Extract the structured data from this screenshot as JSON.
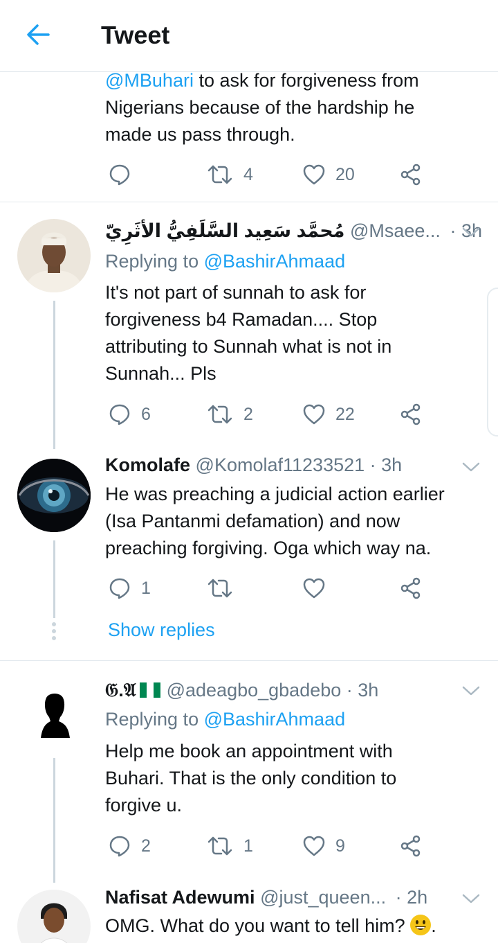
{
  "header": {
    "title": "Tweet"
  },
  "top_tweet": {
    "mention": "@MBuhari",
    "text_rest_line1": " to ask for forgiveness from",
    "text_line2": "Nigerians because of the hardship he",
    "text_line3": "made us pass through.",
    "retweets": "4",
    "likes": "20"
  },
  "replies": [
    {
      "name": "مُحمَّد سَعِيد السَّلَفِيُّ الأثَرِيّ",
      "handle": "@Msaee...",
      "time": "· 3h",
      "replying_label": "Replying to ",
      "replying_to": "@BashirAhmaad",
      "lines": [
        "It's not part of sunnah to ask for",
        "forgiveness b4 Ramadan.... Stop",
        "attributing to Sunnah what is not in",
        "Sunnah... Pls"
      ],
      "replies": "6",
      "retweets": "2",
      "likes": "22"
    },
    {
      "name": "Komolafe",
      "handle": "@Komolaf11233521",
      "time": "· 3h",
      "lines": [
        "He was preaching a judicial action earlier",
        "(Isa Pantanmi defamation) and now",
        "preaching forgiving. Oga which way na."
      ],
      "replies": "1",
      "retweets": "",
      "likes": "",
      "show_replies": "Show replies"
    },
    {
      "name": "𝔊.𝔄",
      "handle": "@adeagbo_gbadebo",
      "time": "· 3h",
      "replying_label": "Replying to ",
      "replying_to": "@BashirAhmaad",
      "lines": [
        "Help me book an appointment with",
        "Buhari. That is the only  condition to",
        "forgive u."
      ],
      "replies": "2",
      "retweets": "1",
      "likes": "9"
    },
    {
      "name": "Nafisat Adewumi",
      "handle": "@just_queen...",
      "time": "· 2h",
      "lines": [
        "OMG. What do you want to tell him?"
      ]
    }
  ],
  "colors": {
    "accent": "#1da1f2",
    "muted": "#657786",
    "text": "#14171a",
    "divider": "#e1e8ed"
  }
}
